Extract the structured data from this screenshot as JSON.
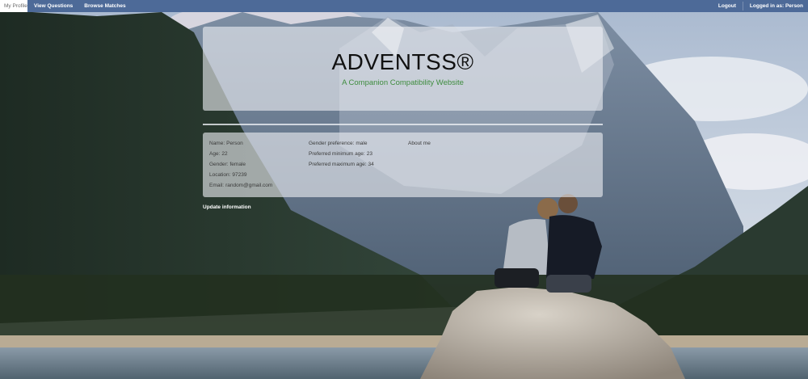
{
  "navbar": {
    "items": [
      {
        "label": "My Profile",
        "active": true
      },
      {
        "label": "View Questions",
        "active": false
      },
      {
        "label": "Browse Matches",
        "active": false
      }
    ],
    "logout_label": "Logout",
    "logged_in_label": "Logged in as: Person"
  },
  "header": {
    "title": "ADVENTSS®",
    "subtitle": "A Companion Compatibility Website"
  },
  "profile": {
    "column1": [
      {
        "label": "Name:",
        "value": "Person"
      },
      {
        "label": "Age:",
        "value": "22"
      },
      {
        "label": "Gender:",
        "value": "female"
      },
      {
        "label": "Location:",
        "value": "97239"
      },
      {
        "label": "Email:",
        "value": "random@gmail.com"
      }
    ],
    "column2": [
      {
        "label": "Gender preference:",
        "value": "male"
      },
      {
        "label": "Preferred minimum age:",
        "value": "23"
      },
      {
        "label": "Preferred maximum age:",
        "value": "34"
      }
    ],
    "about_label": "About me"
  },
  "update_label": "Update information",
  "colors": {
    "navbar": "#4d6a98",
    "subtitle": "#3f8c3f",
    "panel": "#ebeef2"
  }
}
